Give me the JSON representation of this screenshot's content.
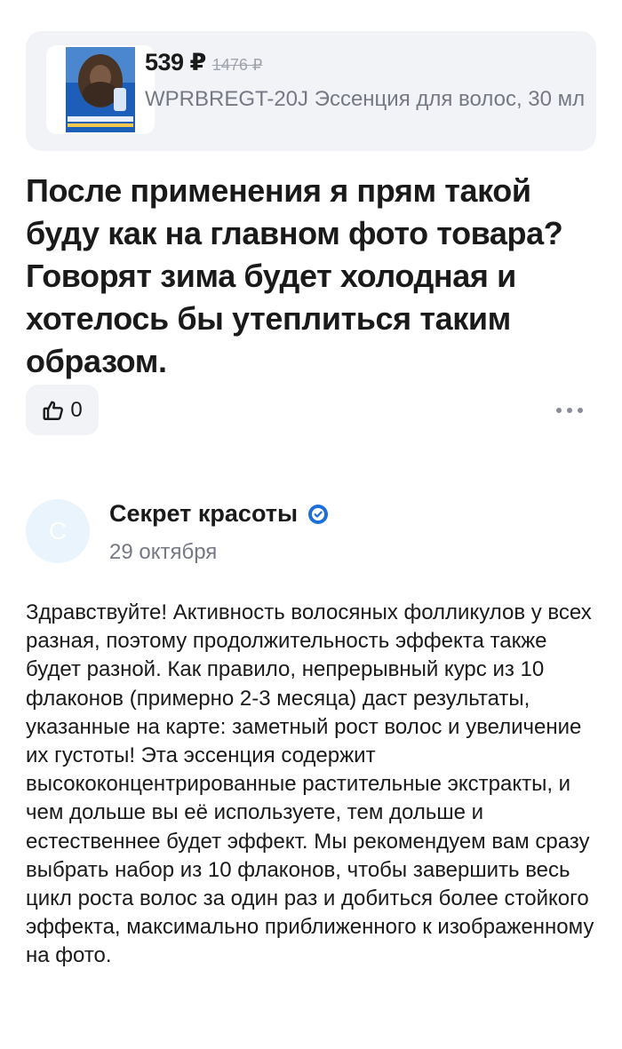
{
  "product": {
    "price": "539 ₽",
    "old_price": "1476 ₽",
    "name": "WPRBREGT-20J Эссенция для волос, 30 мл",
    "image_icon": "product-photo-hair-essence"
  },
  "question": {
    "text": "После применения я прям такой буду как на главном фото товара? Говорят зима будет холодная и хотелось бы утеплиться таким образом."
  },
  "actions": {
    "like_icon": "thumbs-up-icon",
    "like_count": "0",
    "more_icon": "more-horizontal-icon"
  },
  "reply": {
    "avatar_letter": "С",
    "seller_name": "Секрет красоты",
    "verified_icon": "verified-check-icon",
    "date": "29 октября",
    "text": "Здравствуйте! Активность волосяных фолликулов у всех разная, поэтому продолжительность эффекта также будет разной. Как правило, непрерывный курс из 10 флаконов (примерно 2-3 месяца) даст результаты, указанные на карте: заметный рост волос и увеличение их густоты! Эта эссенция содержит высококонцентрированные растительные экстракты, и чем дольше вы её используете, тем дольше и естественнее будет эффект. Мы рекомендуем вам сразу выбрать набор из 10 флаконов, чтобы завершить весь цикл роста волос за один раз и добиться более стойкого эффекта, максимально приближенного к изображенному на фото."
  },
  "colors": {
    "accent_blue": "#1a6fd8",
    "card_bg": "#f2f3f7",
    "muted_text": "#767984"
  }
}
